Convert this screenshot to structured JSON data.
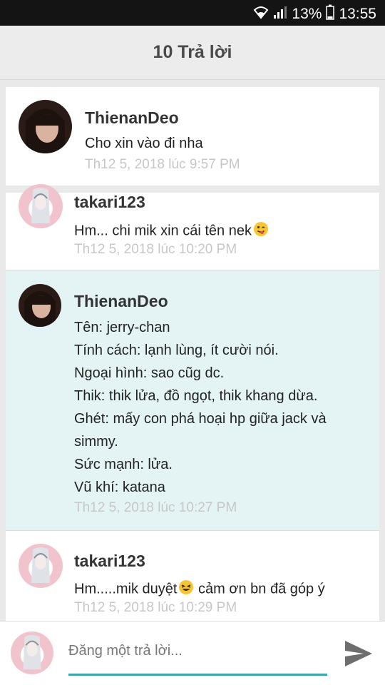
{
  "status_bar": {
    "battery": "13%",
    "time": "13:55"
  },
  "header": {
    "title": "10 Trả lời"
  },
  "comments": [
    {
      "author": "ThienanDeo",
      "lines": [
        "Cho xin vào đi nha"
      ],
      "timestamp": "Th12 5, 2018 lúc 9:57 PM"
    },
    {
      "author": "takari123",
      "lines": [
        "Hm... chi mik xin cái tên nek"
      ],
      "timestamp": "Th12 5, 2018 lúc 10:20 PM",
      "emoji": "wink-tongue-emoji"
    },
    {
      "author": "ThienanDeo",
      "lines": [
        "Tên: jerry-chan",
        "Tính cách: lạnh lùng, ít cười nói.",
        "Ngoại hình: sao cũg dc.",
        "Thik: thik lửa, đồ ngọt, thik khang dừa.",
        "Ghét: mấy con phá hoại hp giữa jack và",
        "simmy.",
        "Sức mạnh: lửa.",
        "Vũ khí: katana"
      ],
      "timestamp": "Th12 5, 2018 lúc 10:27 PM"
    },
    {
      "author": "takari123",
      "line_parts": [
        "Hm.....mik duyệt",
        "cảm ơn bn đã góp ý"
      ],
      "timestamp": "Th12 5, 2018 lúc 10:29 PM",
      "emoji": "laughing-emoji"
    }
  ],
  "composer": {
    "placeholder": "Đăng một trả lời..."
  },
  "colors": {
    "accent": "#3ba6a6",
    "highlight_bg": "#e4f4f4"
  }
}
